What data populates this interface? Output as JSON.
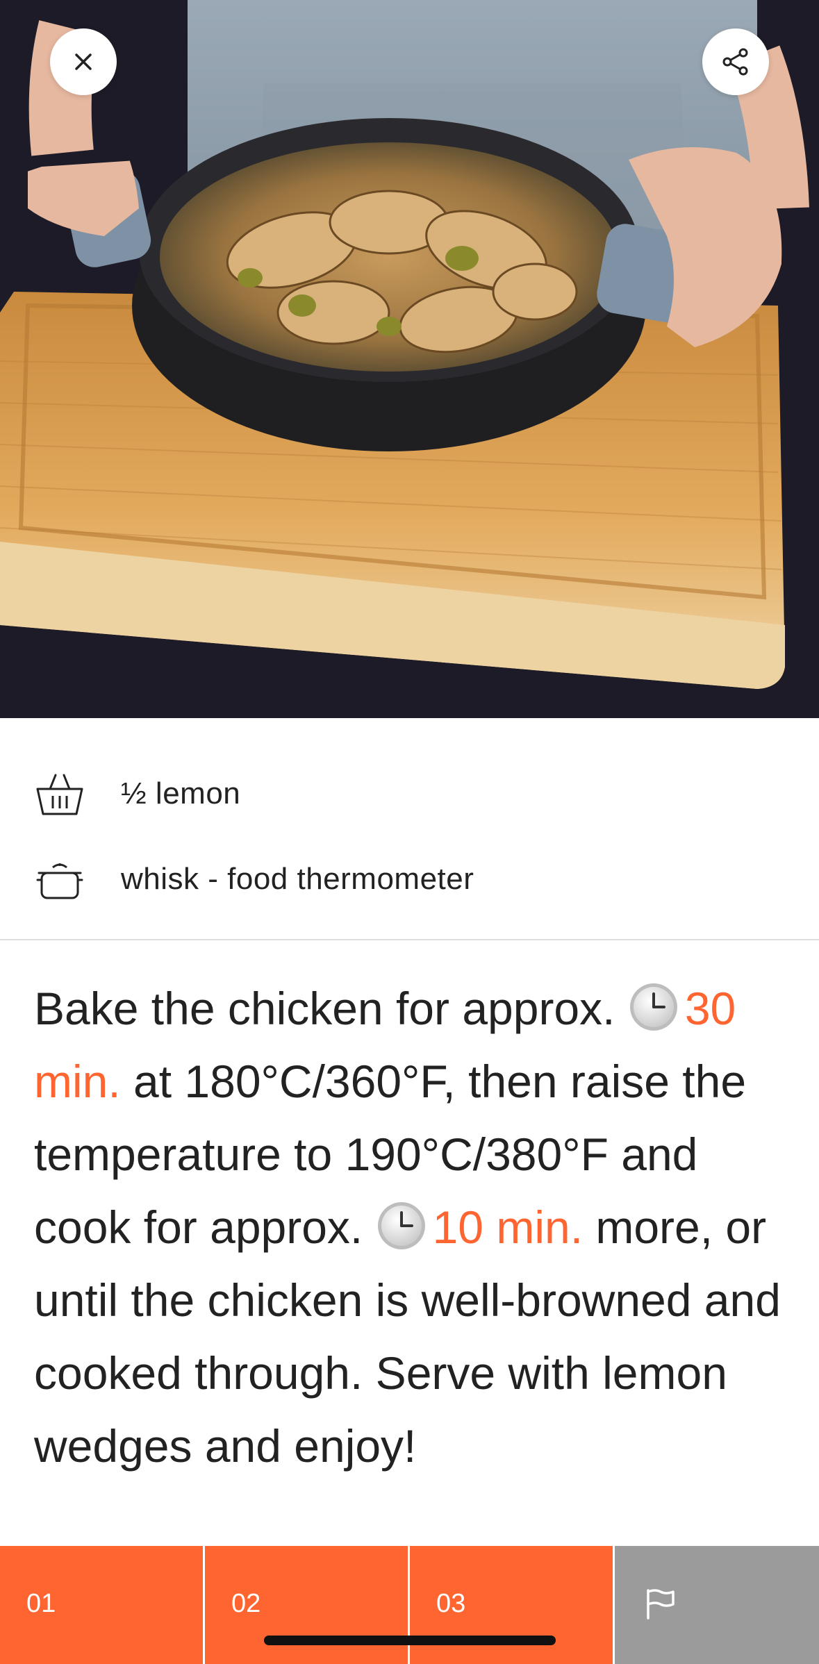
{
  "hero": {
    "image_description_icon": "chicken-pan-photo"
  },
  "toolbar": {
    "close_icon": "close-icon",
    "share_icon": "share-icon"
  },
  "ingredients": [
    {
      "icon": "basket-icon",
      "text": "½ lemon"
    },
    {
      "icon": "pot-icon",
      "text": "whisk - food thermometer"
    }
  ],
  "instructions": {
    "part1": "Bake the chicken for approx.",
    "timer1": "30 min.",
    "part2": "at 180°C/360°F, then raise the temperature to 190°C/380°F and cook for approx.",
    "timer2": "10 min.",
    "part3": "more, or until the chicken is well-browned and cooked through. Serve with lemon wedges and enjoy!"
  },
  "steps": [
    {
      "label": "01"
    },
    {
      "label": "02"
    },
    {
      "label": "03"
    }
  ],
  "finish_icon": "flag-icon",
  "colors": {
    "accent": "#ff6530",
    "finish_tab": "#9b9b9b",
    "text": "#222222"
  }
}
